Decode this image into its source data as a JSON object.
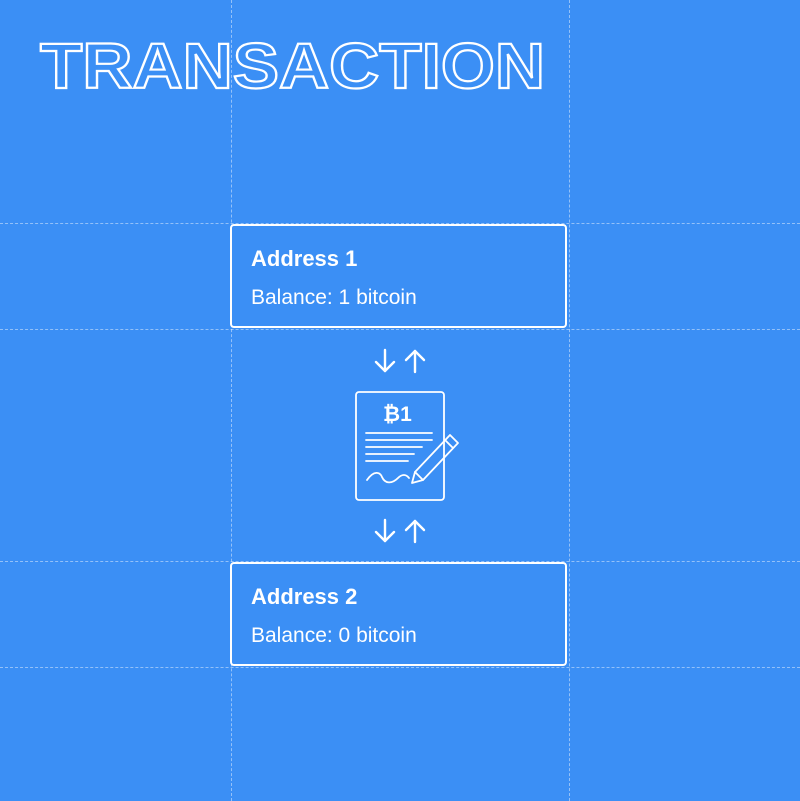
{
  "title": "TRANSACTION",
  "addresses": [
    {
      "name": "Address 1",
      "balance": "Balance: 1 bitcoin"
    },
    {
      "name": "Address 2",
      "balance": "Balance: 0 bitcoin"
    }
  ],
  "document": {
    "amount": "₿1"
  },
  "icons": {
    "arrows": "down-up-arrows-icon",
    "document": "signed-document-icon",
    "pen": "pen-icon"
  },
  "colors": {
    "background": "#3b8ff5",
    "foreground": "#ffffff"
  }
}
